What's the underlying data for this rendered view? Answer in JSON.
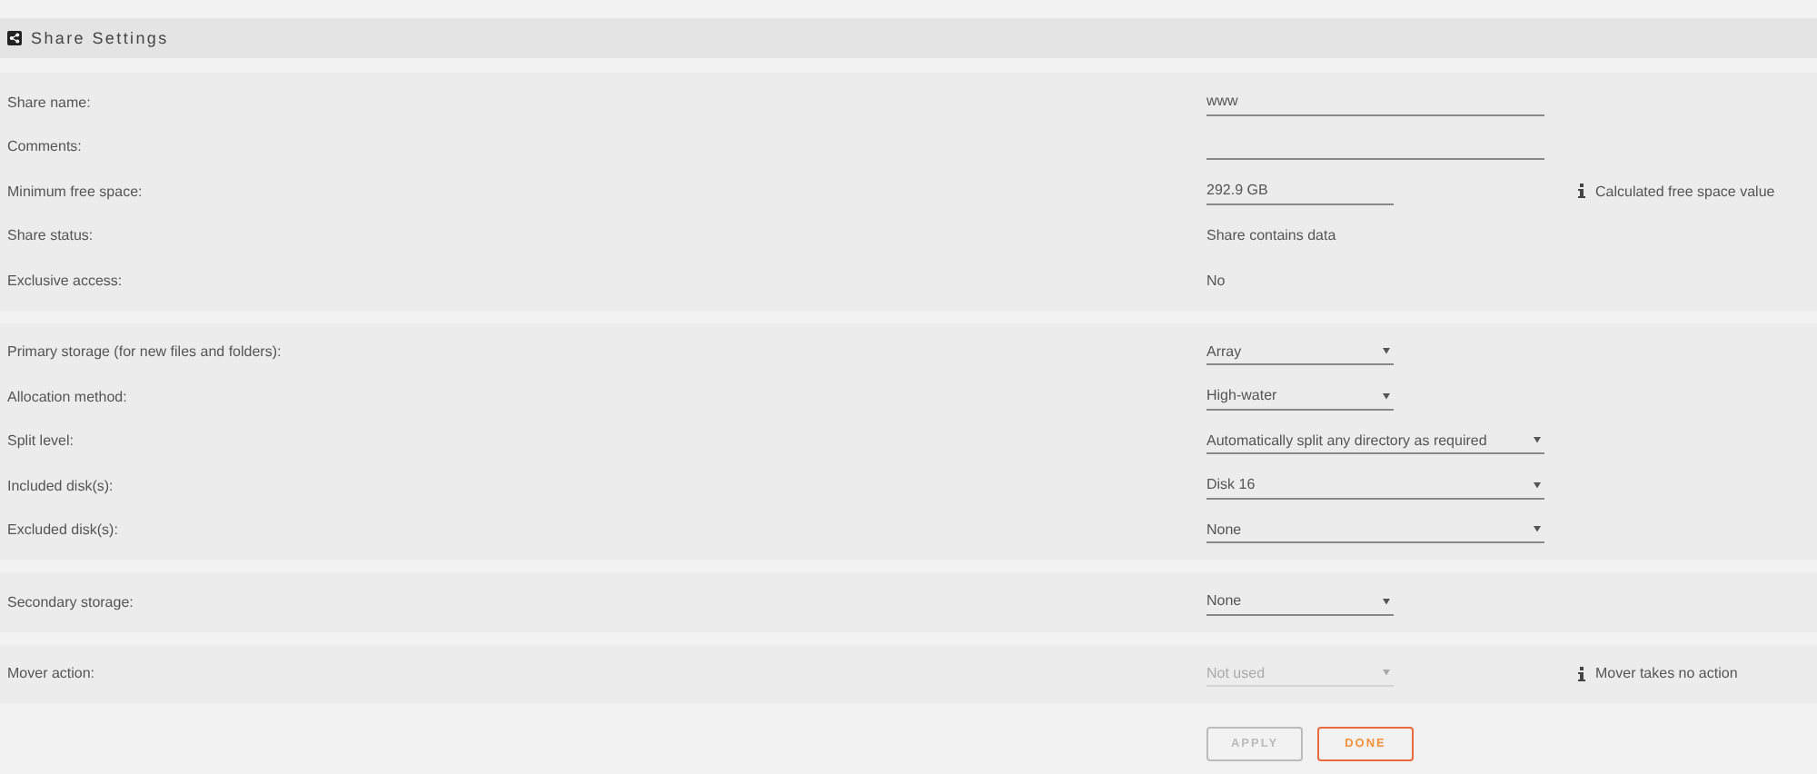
{
  "header": {
    "title": "Share Settings"
  },
  "sections": [
    {
      "rows": [
        {
          "label": "Share name:",
          "kind": "input",
          "value": "www",
          "wide": true
        },
        {
          "label": "Comments:",
          "kind": "input",
          "wide": true
        },
        {
          "label": "Minimum free space:",
          "kind": "input",
          "value": "292.9 GB",
          "wide": false,
          "note": "Calculated free space value"
        },
        {
          "label": "Share status:",
          "kind": "text",
          "value": "Share contains data"
        },
        {
          "label": "Exclusive access:",
          "kind": "text",
          "value": "No"
        }
      ]
    },
    {
      "rows": [
        {
          "label": "Primary storage (for new files and folders):",
          "kind": "select",
          "value": "Array",
          "wide": false,
          "disabled": false
        },
        {
          "label": "Allocation method:",
          "kind": "select",
          "value": "High-water",
          "wide": false,
          "disabled": false
        },
        {
          "label": "Split level:",
          "kind": "select",
          "value": "Automatically split any directory as required",
          "wide": true,
          "disabled": false
        },
        {
          "label": "Included disk(s):",
          "kind": "select",
          "value": "Disk 16",
          "wide": true,
          "disabled": false
        },
        {
          "label": "Excluded disk(s):",
          "kind": "select",
          "value": "None",
          "wide": true,
          "disabled": false
        }
      ]
    },
    {
      "rows": [
        {
          "label": "Secondary storage:",
          "kind": "select",
          "value": "None",
          "wide": false,
          "disabled": false
        }
      ]
    },
    {
      "rows": [
        {
          "label": "Mover action:",
          "kind": "select",
          "value": "Not used",
          "wide": false,
          "disabled": true,
          "note": "Mover takes no action"
        }
      ]
    }
  ],
  "buttons": [
    {
      "label": "APPLY",
      "kind": "secondary",
      "disabled": true
    },
    {
      "label": "DONE",
      "kind": "primary",
      "disabled": false
    }
  ]
}
